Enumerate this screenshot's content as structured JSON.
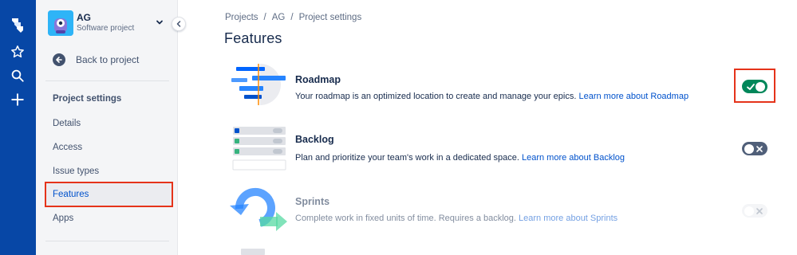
{
  "colors": {
    "rail": "#0747A6",
    "sidebar": "#F4F5F7",
    "link": "#0052CC",
    "toggle_on": "#00875A",
    "toggle_off": "#505F79",
    "annotation": "#E5331A"
  },
  "rail": {
    "icons": [
      "jira-logo-icon",
      "star-icon",
      "search-icon",
      "plus-icon"
    ]
  },
  "project": {
    "name": "AG",
    "type": "Software project"
  },
  "sidebar": {
    "back_label": "Back to project",
    "section_title": "Project settings",
    "items": [
      {
        "label": "Details"
      },
      {
        "label": "Access"
      },
      {
        "label": "Issue types"
      },
      {
        "label": "Features",
        "active": true
      },
      {
        "label": "Apps"
      }
    ]
  },
  "breadcrumb": [
    "Projects",
    "/",
    "AG",
    "/",
    "Project settings"
  ],
  "page_title": "Features",
  "features": [
    {
      "name": "Roadmap",
      "description": "Your roadmap is an optimized location to create and manage your epics.",
      "link": "Learn more about Roadmap",
      "toggle": "on"
    },
    {
      "name": "Backlog",
      "description": "Plan and prioritize your team's work in a dedicated space.",
      "link": "Learn more about Backlog",
      "toggle": "off"
    },
    {
      "name": "Sprints",
      "description": "Complete work in fixed units of time. Requires a backlog.",
      "link": "Learn more about Sprints",
      "toggle": "disabled"
    }
  ]
}
